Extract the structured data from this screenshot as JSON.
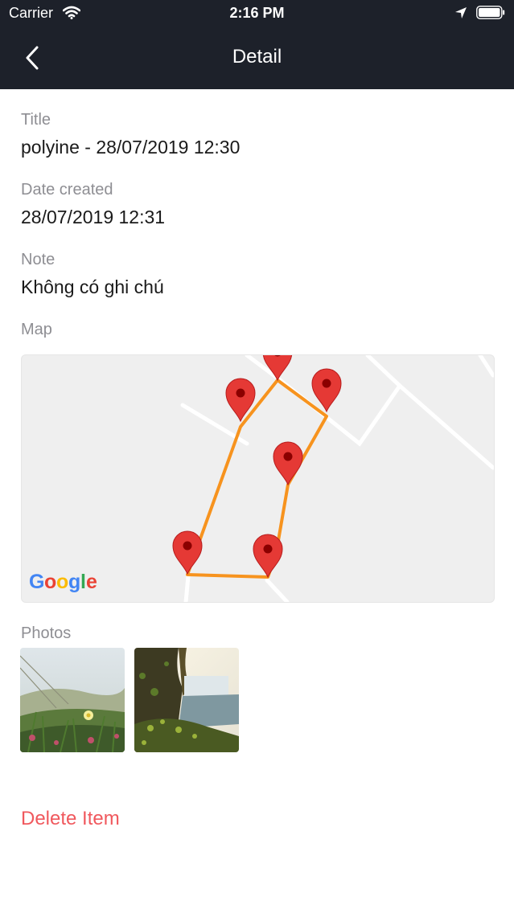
{
  "status_bar": {
    "carrier": "Carrier",
    "time": "2:16 PM"
  },
  "nav": {
    "back_icon": "chevron-left-icon",
    "title": "Detail"
  },
  "fields": {
    "title_label": "Title",
    "title_value": "polyine - 28/07/2019 12:30",
    "date_label": "Date created",
    "date_value": "28/07/2019 12:31",
    "note_label": "Note",
    "note_value": "Không có ghi chú",
    "map_label": "Map",
    "photos_label": "Photos"
  },
  "map": {
    "attribution": "Google",
    "route_color": "#f7931e",
    "marker_color": "#e53935",
    "marker_count": 6
  },
  "photos": [
    {
      "name": "photo-flower-field"
    },
    {
      "name": "photo-waterfall"
    }
  ],
  "actions": {
    "delete_label": "Delete Item",
    "delete_color": "#f0585d"
  }
}
